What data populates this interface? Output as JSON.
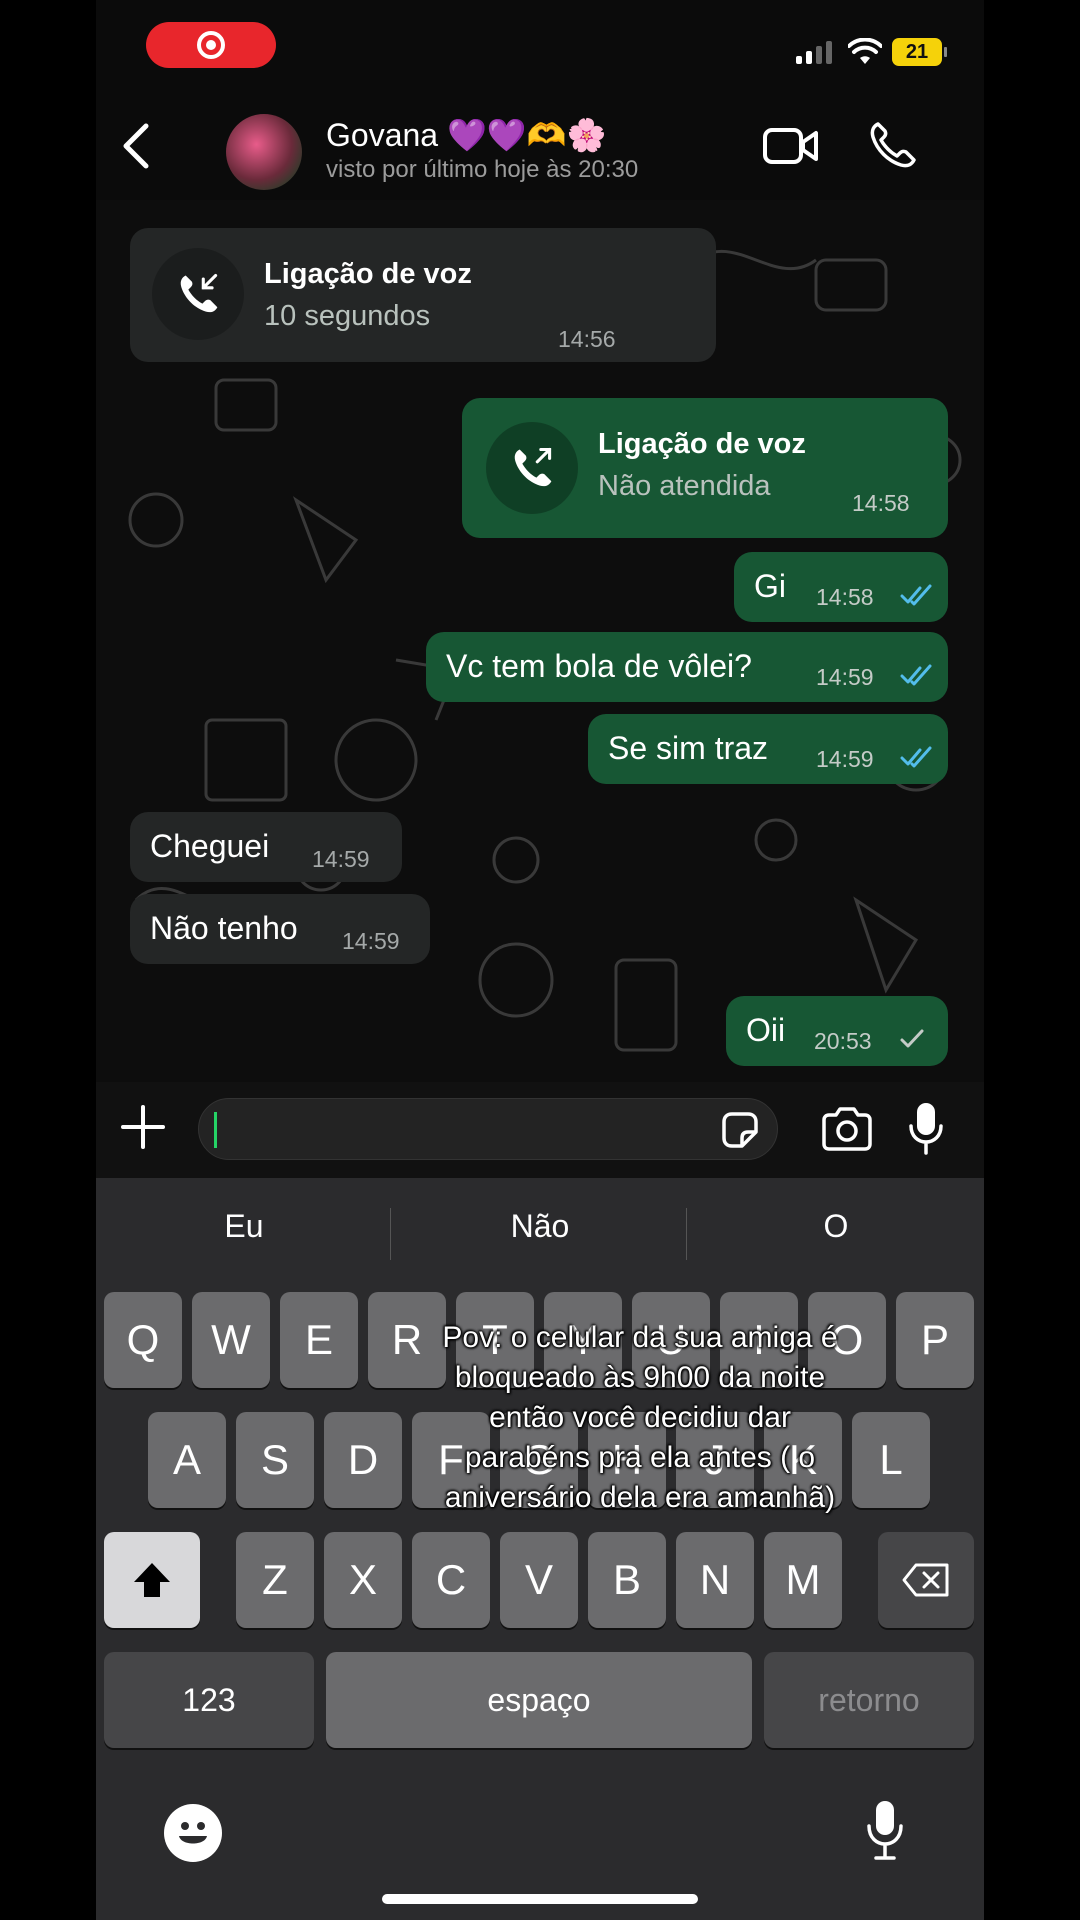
{
  "status_bar": {
    "battery": "21"
  },
  "header": {
    "contact_name": "Govana 💜💜🫶🌸",
    "last_seen": "visto por último hoje às 20:30"
  },
  "messages": [
    {
      "type": "call",
      "direction": "in",
      "title": "Ligação de voz",
      "subtitle": "10 segundos",
      "time": "14:56"
    },
    {
      "type": "call",
      "direction": "out",
      "title": "Ligação de voz",
      "subtitle": "Não atendida",
      "time": "14:58"
    },
    {
      "type": "text",
      "direction": "out",
      "text": "Gi",
      "time": "14:58",
      "status": "read"
    },
    {
      "type": "text",
      "direction": "out",
      "text": "Vc tem bola de vôlei?",
      "time": "14:59",
      "status": "read"
    },
    {
      "type": "text",
      "direction": "out",
      "text": "Se sim traz",
      "time": "14:59",
      "status": "read"
    },
    {
      "type": "text",
      "direction": "in",
      "text": "Cheguei",
      "time": "14:59"
    },
    {
      "type": "text",
      "direction": "in",
      "text": "Não tenho",
      "time": "14:59"
    },
    {
      "type": "text",
      "direction": "out",
      "text": "Oii",
      "time": "20:53",
      "status": "sent"
    }
  ],
  "keyboard": {
    "suggestions": [
      "Eu",
      "Não",
      "O"
    ],
    "row1": [
      "Q",
      "W",
      "E",
      "R",
      "T",
      "Y",
      "U",
      "I",
      "O",
      "P"
    ],
    "row2": [
      "A",
      "S",
      "D",
      "F",
      "G",
      "H",
      "J",
      "K",
      "L"
    ],
    "row3": [
      "Z",
      "X",
      "C",
      "V",
      "B",
      "N",
      "M"
    ],
    "numbers_key": "123",
    "space_key": "espaço",
    "return_key": "retorno"
  },
  "caption": "Pov: o celular da sua amiga é bloqueado às 9h00 da noite então você decidiu dar parabéns pra ela antes ( o aniversário dela era amanhã)",
  "colors": {
    "outgoing_bubble": "#175734",
    "incoming_bubble": "#242626",
    "read_ticks": "#53bdeb",
    "accent": "#25d366"
  }
}
